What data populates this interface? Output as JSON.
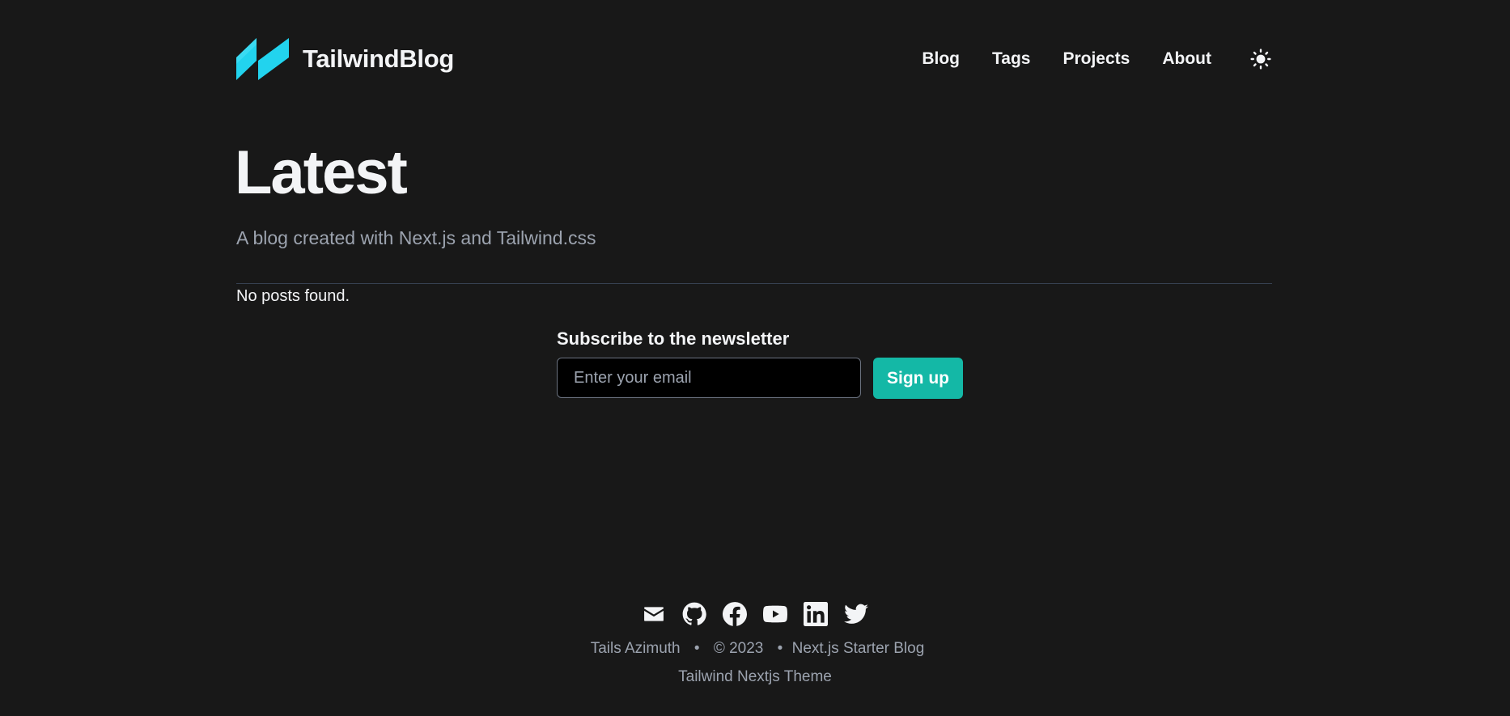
{
  "header": {
    "site_title": "TailwindBlog",
    "nav": [
      {
        "label": "Blog"
      },
      {
        "label": "Tags"
      },
      {
        "label": "Projects"
      },
      {
        "label": "About"
      }
    ],
    "theme_toggle_icon": "sun-icon"
  },
  "main": {
    "title": "Latest",
    "subtitle": "A blog created with Next.js and Tailwind.css",
    "empty_message": "No posts found."
  },
  "newsletter": {
    "title": "Subscribe to the newsletter",
    "email_placeholder": "Enter your email",
    "signup_label": "Sign up"
  },
  "footer": {
    "social_icons": [
      "mail-icon",
      "github-icon",
      "facebook-icon",
      "youtube-icon",
      "linkedin-icon",
      "twitter-icon"
    ],
    "author": "Tails Azimuth",
    "separator": "•",
    "copyright": "© 2023",
    "site_link": "Next.js Starter Blog",
    "theme_link": "Tailwind Nextjs Theme"
  },
  "colors": {
    "background": "#181818",
    "accent": "#14b8a6",
    "logo": "#22d3ee"
  }
}
